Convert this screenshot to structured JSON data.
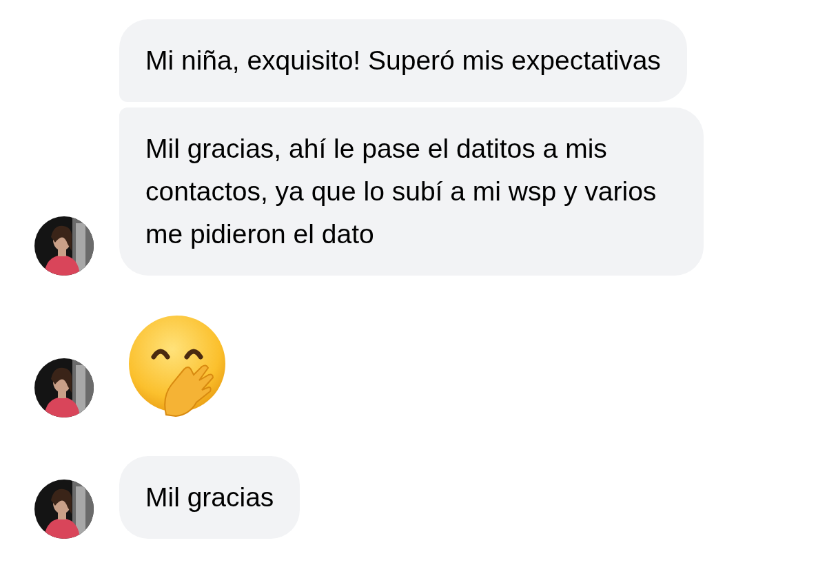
{
  "groups": [
    {
      "messages": [
        {
          "kind": "text",
          "text": "Mi niña, exquisito! Superó mis expectativas"
        },
        {
          "kind": "text",
          "text": "Mil gracias, ahí le pase el datitos a mis contactos, ya que lo subí a mi wsp y varios me pidieron el dato"
        }
      ]
    },
    {
      "messages": [
        {
          "kind": "emoji"
        }
      ]
    },
    {
      "messages": [
        {
          "kind": "text",
          "text": "Mil gracias"
        }
      ]
    }
  ]
}
